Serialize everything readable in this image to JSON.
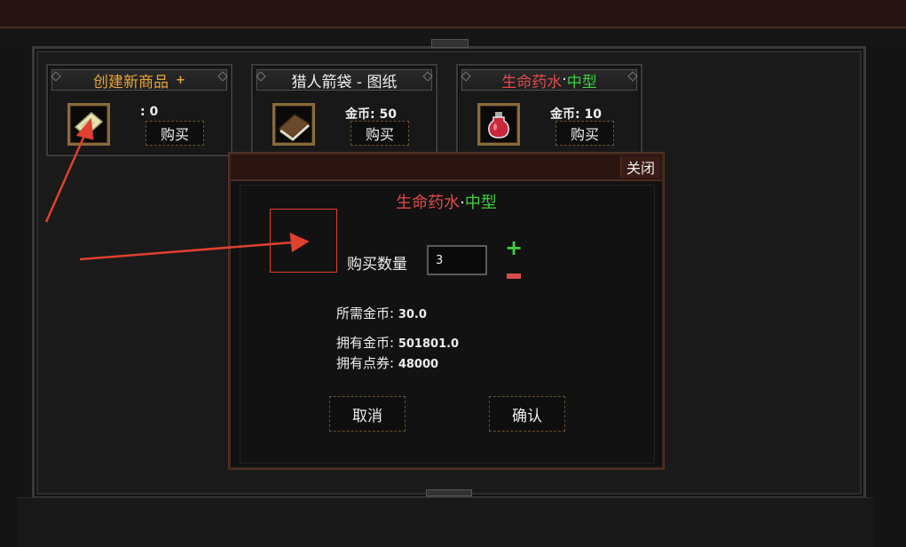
{
  "shop": {
    "cards": [
      {
        "title": "创建新商品",
        "title_suffix": "+",
        "price": ": 0",
        "buy_label": "购买",
        "icon": "scroll-icon"
      },
      {
        "title": "猎人箭袋 - 图纸",
        "price": "金币: 50",
        "buy_label": "购买",
        "icon": "book-icon"
      },
      {
        "title": "生命药水",
        "title_dot": "·",
        "title_suffix": "中型",
        "price": "金币: 10",
        "buy_label": "购买",
        "icon": "potion-icon"
      }
    ]
  },
  "dialog": {
    "close_label": "关闭",
    "item_name": "生命药水",
    "item_dot": "·",
    "item_size": "中型",
    "quantity_label": "购买数量",
    "quantity_value": "3",
    "plus_label": "+",
    "required_label": "所需金币:",
    "required_value": "30.0",
    "owned_gold_label": "拥有金币:",
    "owned_gold_value": "501801.0",
    "owned_points_label": "拥有点券:",
    "owned_points_value": "48000",
    "cancel_label": "取消",
    "confirm_label": "确认"
  },
  "colors": {
    "gold_title": "#e8a43a",
    "red_title": "#e04a4a",
    "green_title": "#3fcf3f",
    "annotation": "#e04030"
  }
}
